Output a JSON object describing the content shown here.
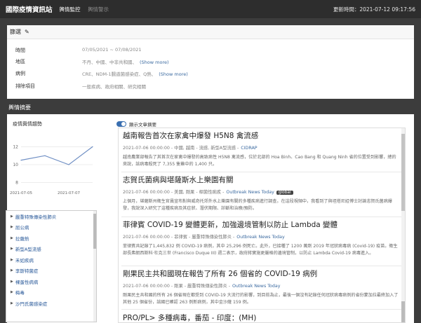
{
  "header": {
    "brand": "國際疫情資訊站",
    "nav": [
      {
        "label": "輿情監控",
        "active": true
      },
      {
        "label": "輿情警示",
        "active": false
      }
    ],
    "updated_label": "更新時間：2021-07-12 09:17:56"
  },
  "filter": {
    "title": "篩選",
    "edit_icon": "pencil-icon",
    "rows": [
      {
        "label": "時間",
        "value": "07/05/2021 ~ 07/08/2021",
        "more": ""
      },
      {
        "label": "地區",
        "value": "不丹、中國、中非共和國、",
        "more": "(Show more)"
      },
      {
        "label": "病例",
        "value": "CRE、NDM-1腸道菌感染症、Q熱、",
        "more": "(Show more)"
      },
      {
        "label": "排除項目",
        "value": "一般疾病、政府相關、研究相關",
        "more": ""
      }
    ]
  },
  "summary": {
    "title": "輿情摘要",
    "trend_title": "疫情輿情趨勢",
    "toggle_label": "顯示文章摘要",
    "toggle_on": true
  },
  "chart_data": {
    "type": "line",
    "x": [
      "2021-07-05",
      "2021-07-06",
      "2021-07-07",
      "2021-07-08"
    ],
    "series": [
      {
        "values": [
          10.5,
          11,
          10,
          12
        ]
      }
    ],
    "xticks": [
      "2021-07-05",
      "2021-07-07"
    ],
    "yticks": [
      8,
      10,
      12
    ],
    "ylim": [
      7.5,
      12.5
    ],
    "grid": true,
    "color": "#6f8fc4"
  },
  "categories": [
    "嚴重特殊傳染性肺炎",
    "屈公病",
    "拉薩熱",
    "新型A型流感",
    "禾如疾病",
    "李斯特菌症",
    "裸蛋性病病",
    "梅毒",
    "沙門氏菌感染症"
  ],
  "articles": [
    {
      "title": "越南報告首次在家禽中爆發 H5N8 禽流感",
      "meta": "2021-07-06 00:00:00 - 中國, 越南 - 流感, 新型A型流感 -",
      "source": "CIDRAP",
      "tag": "",
      "body": "越南農業部報告了其首次在家禽中爆發的高致病性 H5N8 禽流感，位於北部的 Hoa Binh、Cao Bang 和 Quang Ninh 省的位置受到影響，總的來說，該病毒殺死了 7,355 隻雞中的 1,400 只。"
    },
    {
      "title": "志賀氏菌病與堪薩斯水上樂園有關",
      "meta": "2021-07-06 00:00:00 - 美國, 剛果 - 桿菌性痢疾 -",
      "source": "Outbreak News Today",
      "tag": "global",
      "body": "上個月，堪薩斯州衛生官員宣布對與威奇托郊外水上樂園有關的多種疾病進行調查。在這段視頻中，我看到了與坦塔尼婭博士討論志賀氏菌病爆發，我說深入研究了這種疾病及其症狀、潛伏期限、診斷和治療/預防。"
    },
    {
      "title": "菲律賓 COVID-19 變體更新，加強邊境管制以防止 Lambda 變體",
      "meta": "2021-07-06 00:00:00 - 菲律賓 - 嚴重特殊傳染性肺炎 -",
      "source": "Outbreak News Today",
      "tag": "",
      "body": "菲律賓共記錄了1,445,832 例 COVID-19 病例，其中 25,296 例死亡。此外，已接種了 1200 萬劑 2019 年冠狀病毒病 (Covid-19) 疫苗。衛生部長弗朗西斯科·杜克三世 (Francisco Duque III) 週二表示，政府將實施更嚴格的邊境管制，以防止 Lambda Covid-19 病毒進入。"
    },
    {
      "title": "剛果民主共和國現在報告了所有 26 個省的 COVID-19 病例",
      "meta": "2021-07-06 00:00:00 - 剛果 - 嚴重特殊傳染性肺炎 -",
      "source": "Outbreak News Today",
      "tag": "",
      "body": "剛果民主共和國的所有 26 個省現在都受到 COVID-19 大流行的影響，到目前為止，最後一個沒有記錄任何冠狀病毒病例的省份蒙加拉最終加入了其他 25 個省份，該國已確認 263 例新病例，其中金沙薩 159 例。"
    },
    {
      "title": "PRO/PL> 多種病毒，番茄 - 印度：(MH)",
      "meta": "",
      "source": "",
      "tag": "",
      "body": ""
    }
  ]
}
